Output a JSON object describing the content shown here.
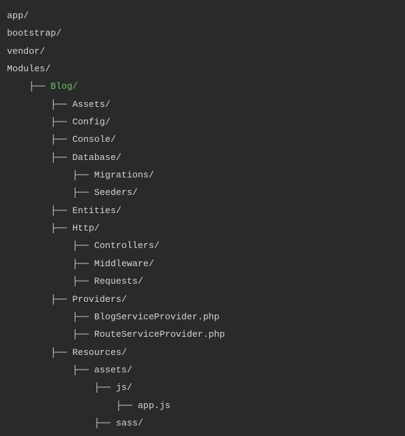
{
  "tree": [
    {
      "text": "app/",
      "indent": 0,
      "branch": "",
      "highlight": false
    },
    {
      "text": "bootstrap/",
      "indent": 0,
      "branch": "",
      "highlight": false
    },
    {
      "text": "vendor/",
      "indent": 0,
      "branch": "",
      "highlight": false
    },
    {
      "text": "Modules/",
      "indent": 0,
      "branch": "",
      "highlight": false
    },
    {
      "text": "Blog/",
      "indent": 1,
      "branch": "├── ",
      "highlight": true
    },
    {
      "text": "Assets/",
      "indent": 2,
      "branch": "├── ",
      "highlight": false
    },
    {
      "text": "Config/",
      "indent": 2,
      "branch": "├── ",
      "highlight": false
    },
    {
      "text": "Console/",
      "indent": 2,
      "branch": "├── ",
      "highlight": false
    },
    {
      "text": "Database/",
      "indent": 2,
      "branch": "├── ",
      "highlight": false
    },
    {
      "text": "Migrations/",
      "indent": 3,
      "branch": "├── ",
      "highlight": false
    },
    {
      "text": "Seeders/",
      "indent": 3,
      "branch": "├── ",
      "highlight": false
    },
    {
      "text": "Entities/",
      "indent": 2,
      "branch": "├── ",
      "highlight": false
    },
    {
      "text": "Http/",
      "indent": 2,
      "branch": "├── ",
      "highlight": false
    },
    {
      "text": "Controllers/",
      "indent": 3,
      "branch": "├── ",
      "highlight": false
    },
    {
      "text": "Middleware/",
      "indent": 3,
      "branch": "├── ",
      "highlight": false
    },
    {
      "text": "Requests/",
      "indent": 3,
      "branch": "├── ",
      "highlight": false
    },
    {
      "text": "Providers/",
      "indent": 2,
      "branch": "├── ",
      "highlight": false
    },
    {
      "text": "BlogServiceProvider.php",
      "indent": 3,
      "branch": "├── ",
      "highlight": false
    },
    {
      "text": "RouteServiceProvider.php",
      "indent": 3,
      "branch": "├── ",
      "highlight": false
    },
    {
      "text": "Resources/",
      "indent": 2,
      "branch": "├── ",
      "highlight": false
    },
    {
      "text": "assets/",
      "indent": 3,
      "branch": "├── ",
      "highlight": false
    },
    {
      "text": "js/",
      "indent": 4,
      "branch": "├── ",
      "highlight": false
    },
    {
      "text": "app.js",
      "indent": 5,
      "branch": "├── ",
      "highlight": false
    },
    {
      "text": "sass/",
      "indent": 4,
      "branch": "├── ",
      "highlight": false
    }
  ],
  "indent_unit": "    "
}
